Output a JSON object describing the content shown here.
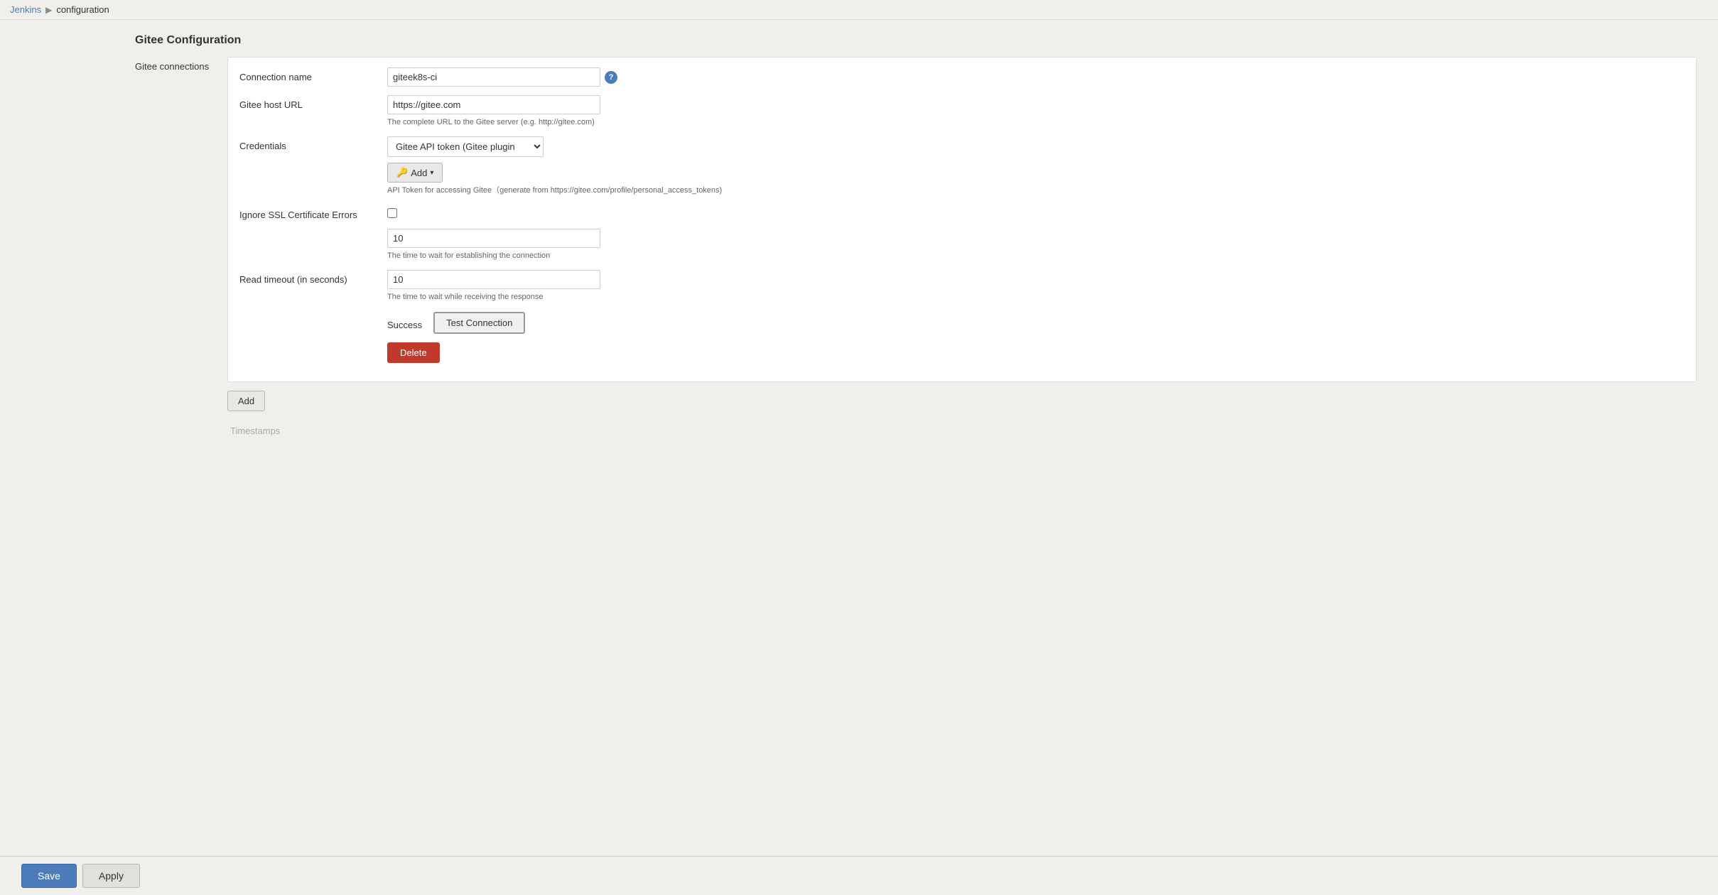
{
  "breadcrumb": {
    "home_label": "Jenkins",
    "separator": "▶",
    "current_label": "configuration"
  },
  "page": {
    "section_title": "Gitee Configuration",
    "connections_label": "Gitee connections"
  },
  "form": {
    "connection_name_label": "Connection name",
    "connection_name_value": "giteek8s-ci",
    "gitee_host_url_label": "Gitee host URL",
    "gitee_host_url_value": "https://gitee.com",
    "gitee_host_url_hint": "The complete URL to the Gitee server (e.g. http://gitee.com)",
    "credentials_label": "Credentials",
    "credentials_option": "Gitee API token (Gitee plugin",
    "add_button_label": "Add",
    "api_token_hint": "API Token for accessing Gitee（generate from https://gitee.com/profile/personal_access_tokens)",
    "ignore_ssl_label": "Ignore SSL Certificate Errors",
    "connection_timeout_value": "10",
    "connection_timeout_hint": "The time to wait for establishing the connection",
    "read_timeout_label": "Read timeout (in seconds)",
    "read_timeout_value": "10",
    "read_timeout_hint": "The time to wait while receiving the response",
    "success_label": "Success",
    "test_connection_label": "Test Connection",
    "delete_button_label": "Delete",
    "add_more_label": "Add",
    "timestamps_label": "Timestamps"
  },
  "toolbar": {
    "save_label": "Save",
    "apply_label": "Apply"
  },
  "icons": {
    "help": "?",
    "key": "🔑",
    "dropdown": "▾"
  }
}
